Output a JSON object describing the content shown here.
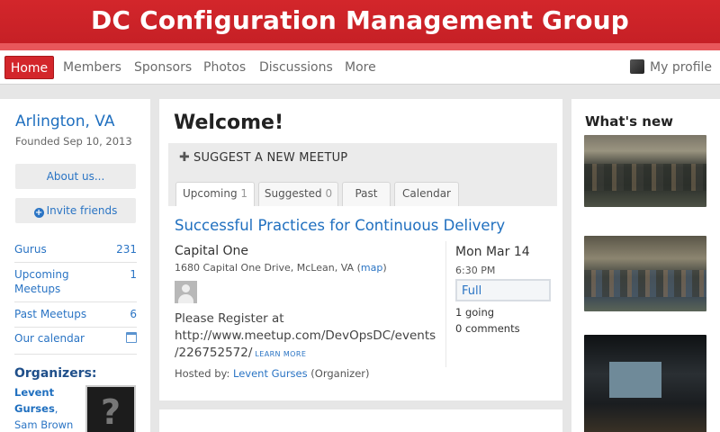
{
  "header": {
    "title": "DC Configuration Management Group"
  },
  "nav": {
    "home": "Home",
    "members": "Members",
    "sponsors": "Sponsors",
    "photos": "Photos",
    "discussions": "Discussions",
    "more": "More",
    "profile": "My profile"
  },
  "sidebar": {
    "city": "Arlington, VA",
    "founded": "Founded Sep 10, 2013",
    "about_button": "About us...",
    "invite_button": "Invite friends",
    "stats": [
      {
        "label": "Gurus",
        "value": "231"
      },
      {
        "label": "Upcoming",
        "label2": "Meetups",
        "value": "1"
      },
      {
        "label": "Past Meetups",
        "value": "6"
      },
      {
        "label": "Our calendar"
      }
    ],
    "organizers_heading": "Organizers:",
    "organizer1": "Levent Gurses",
    "organizer_sep": ", ",
    "organizer2": "Sam Brown"
  },
  "main": {
    "welcome": "Welcome!",
    "suggest": "SUGGEST A NEW MEETUP",
    "tabs": [
      {
        "label": "Upcoming",
        "count": "1"
      },
      {
        "label": "Suggested",
        "count": "0"
      },
      {
        "label": "Past"
      },
      {
        "label": "Calendar"
      }
    ],
    "event": {
      "title": "Successful Practices for Continuous Delivery",
      "venue": "Capital One",
      "address": "1680 Capital One Drive, McLean, VA",
      "map_link": "map",
      "desc_line1": "Please Register at",
      "desc_line2": "http://www.meetup.com/DevOpsDC/events",
      "desc_line3": "/226752572/",
      "learn_more": "LEARN MORE",
      "hosted_prefix": "Hosted by:",
      "host": "Levent Gurses",
      "host_suffix": "(Organizer)",
      "date": "Mon Mar 14",
      "time": "6:30 PM",
      "status": "Full",
      "going": "1  going",
      "comments": "0  comments"
    }
  },
  "whats_new": {
    "title": "What's new"
  },
  "colors": {
    "brand_red": "#d3262b",
    "link_blue": "#2a74c4"
  }
}
